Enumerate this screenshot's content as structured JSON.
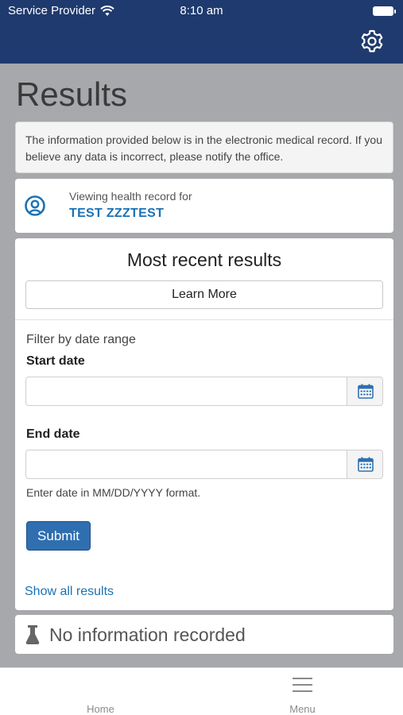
{
  "status_bar": {
    "carrier": "Service Provider",
    "time": "8:10 am"
  },
  "header": {
    "settings_icon": "gear-icon"
  },
  "page": {
    "title": "Results"
  },
  "notice": {
    "text": "The information provided below is in the electronic medical record. If you believe any data is incorrect, please notify the office."
  },
  "patient": {
    "viewing_label": "Viewing health record for",
    "name": "TEST ZZZTEST"
  },
  "results_card": {
    "title": "Most recent results",
    "learn_more_label": "Learn More",
    "filter_label": "Filter by date range",
    "start_date_label": "Start date",
    "start_date_value": "",
    "end_date_label": "End date",
    "end_date_value": "",
    "hint": "Enter date in MM/DD/YYYY format.",
    "submit_label": "Submit",
    "show_all_label": "Show all results"
  },
  "no_info": {
    "text": "No information recorded"
  },
  "tabbar": {
    "home_label": "Home",
    "menu_label": "Menu"
  },
  "colors": {
    "header_bg": "#1f3a6e",
    "page_bg": "#a7a8ab",
    "accent": "#1a72b5",
    "submit_bg": "#2f6fb0"
  }
}
